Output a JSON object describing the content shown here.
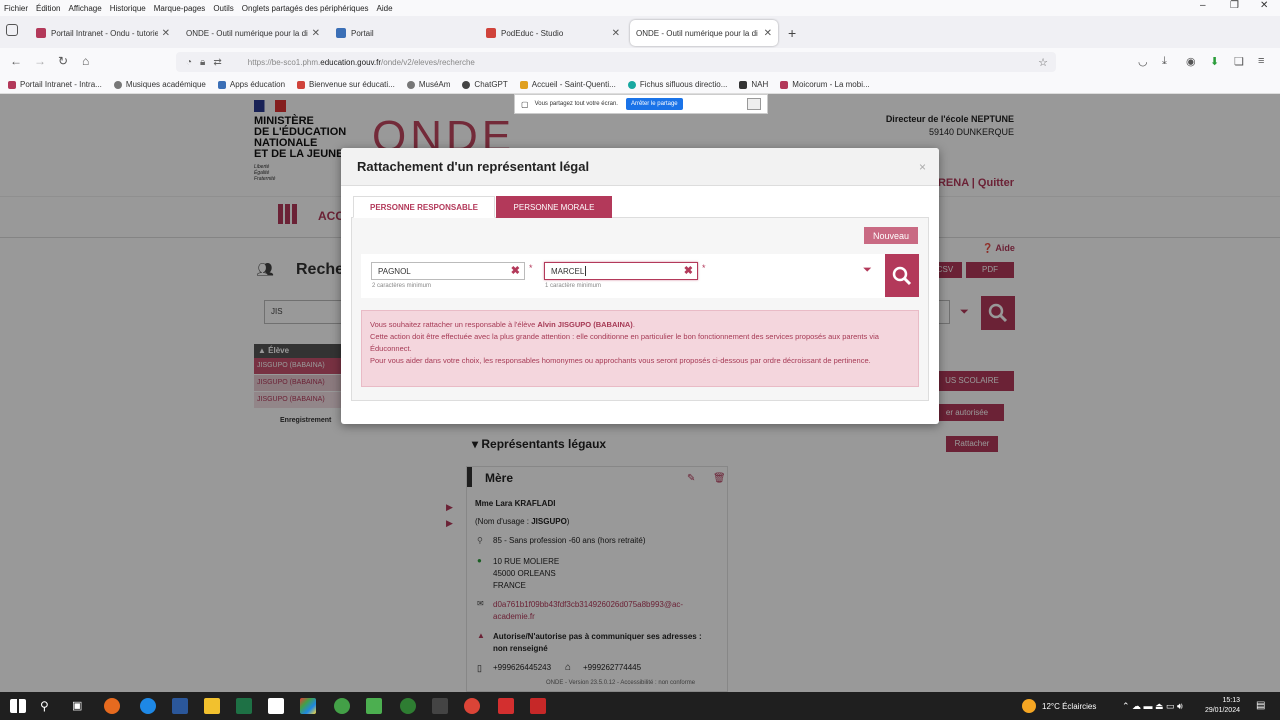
{
  "browser": {
    "menu_items": [
      "Fichier",
      "Édition",
      "Affichage",
      "Historique",
      "Marque-pages",
      "Outils",
      "Onglets partagés des périphériques",
      "Aide"
    ],
    "tabs": [
      {
        "label": "Portail Intranet - Ondu - tutoriels",
        "active": false
      },
      {
        "label": "ONDE - Outil numérique pour la di",
        "active": false
      },
      {
        "label": "Portail",
        "active": false
      },
      {
        "label": "PodEduc - Studio",
        "active": false
      },
      {
        "label": "ONDE - Outil numérique pour la di",
        "active": true
      }
    ],
    "url_prefix": "https://be-sco1.phm.",
    "url_domain": "education.gouv.fr",
    "url_path": "/onde/v2/eleves/recherche",
    "bookmarks": [
      "Portail Intranet - Intra...",
      "Musiques académique",
      "Apps éducation",
      "Bienvenue sur éducati...",
      "MuséAm",
      "ChatGPT",
      "Accueil - Saint-Quenti...",
      "Fichus sifluous directio...",
      "NAH",
      "Moicorum - La mobi..."
    ],
    "share_text": "Vous partagez tout votre écran.",
    "share_stop": "Arrêter le partage"
  },
  "page": {
    "ministry_lines": [
      "MINISTÈRE",
      "DE L'ÉDUCATION",
      "NATIONALE",
      "ET DE LA JEUNE"
    ],
    "ministry_motto": [
      "Liberté",
      "Égalité",
      "Fraternité"
    ],
    "app_logo": "ONDE",
    "director_line": "Directeur de l'école NEPTUNE",
    "director_city": "59140 DUNKERQUE",
    "header_links": "RENA | Quitter",
    "nav_acc": "ACC",
    "search_title": "Reche",
    "search_value": "JIS",
    "aide": "Aide",
    "csv": "CSV",
    "pdf": "PDF",
    "student_list_header": "Élève",
    "students": [
      "JISGUPO (BABAINA)",
      "JISGUPO (BABAINA)",
      "JISGUPO (BABAINA)"
    ],
    "enregistrement": "Enregistrement",
    "scolaire_btn": "US SCOLAIRE",
    "autorisee_btn": "er autorisée",
    "rattacher_btn": "Rattacher",
    "representants_title": "Représentants légaux",
    "mere": {
      "title": "Mère",
      "name": "Mme Lara KRAFLADI",
      "usage_prefix": "(Nom d'usage : ",
      "usage_name": "JISGUPO",
      "usage_suffix": ")",
      "profession": "85 - Sans profession -60 ans (hors retraité)",
      "address": [
        "10 RUE MOLIERE",
        "45000 ORLEANS",
        "FRANCE"
      ],
      "email": [
        "d0a761b1f09bb43fdf3cb314926026d075a8b993@ac-",
        "academie.fr"
      ],
      "authorisation": [
        "Autorise/N'autorise pas à communiquer ses adresses :",
        "non renseigné"
      ],
      "phone1": "+999626445243",
      "phone2": "+999262774445"
    },
    "footer": "ONDE - Version 23.5.0.12 - Accessibilité : non conforme"
  },
  "modal": {
    "title": "Rattachement d'un représentant légal",
    "close": "×",
    "tab_responsable": "PERSONNE RESPONSABLE",
    "tab_morale": "PERSONNE MORALE",
    "nouveau": "Nouveau",
    "nom_value": "PAGNOL",
    "nom_hint": "2 caractères minimum",
    "prenom_value": "MARCEL",
    "prenom_hint": "1 caractère minimum",
    "alert_line1_prefix": "Vous souhaitez rattacher un responsable à l'élève ",
    "alert_student": "Alvin JISGUPO (BABAINA)",
    "alert_line1_suffix": ".",
    "alert_line2": "Cette action doit être effectuée avec la plus grande attention : elle conditionne en particulier le bon fonctionnement des services proposés aux parents via Éduconnect.",
    "alert_line3": "Pour vous aider dans votre choix, les responsables homonymes ou approchants vous seront proposés ci-dessous par ordre décroissant de pertinence."
  },
  "taskbar": {
    "weather": "12°C  Éclaircies",
    "time": "15:13",
    "date": "29/01/2024"
  },
  "colors": {
    "accent": "#b3395a",
    "alert_bg": "#f4d6dd"
  }
}
